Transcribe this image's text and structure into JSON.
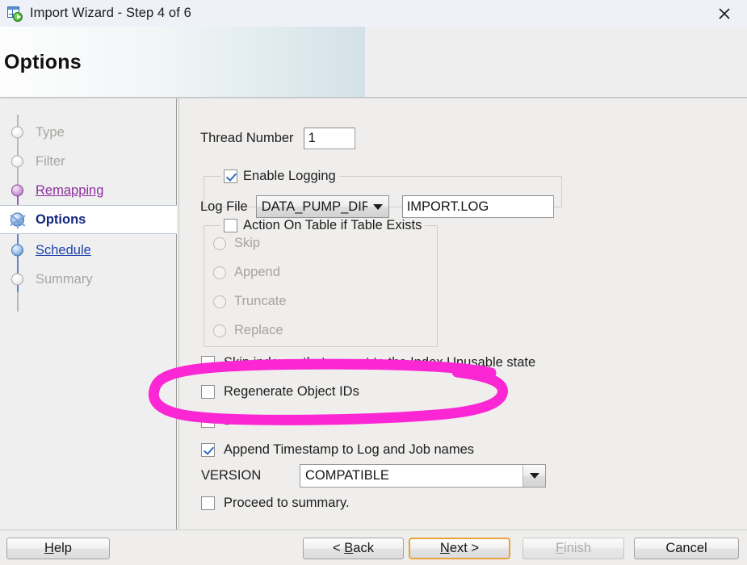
{
  "window": {
    "title": "Import Wizard - Step 4 of 6",
    "icon": "import-table-play-icon",
    "close_label": "✕"
  },
  "header": {
    "title": "Options"
  },
  "sidebar": {
    "items": [
      {
        "label": "Type",
        "state": "done-dim",
        "icon": "step-node-gray-icon"
      },
      {
        "label": "Filter",
        "state": "done-dim",
        "icon": "step-node-gray-icon"
      },
      {
        "label": "Remapping",
        "state": "visited",
        "icon": "step-node-purple-icon"
      },
      {
        "label": "Options",
        "state": "current",
        "icon": "step-node-current-icon"
      },
      {
        "label": "Schedule",
        "state": "link",
        "icon": "step-node-blue-icon"
      },
      {
        "label": "Summary",
        "state": "done-dim",
        "icon": "step-node-gray-icon"
      }
    ]
  },
  "form": {
    "thread_number": {
      "label": "Thread Number",
      "value": "1"
    },
    "logging": {
      "group_label": "Enable Logging",
      "checked": true,
      "log_file_label": "Log File",
      "directory": "DATA_PUMP_DIR",
      "file_name": "IMPORT.LOG"
    },
    "table_action": {
      "group_label": "Action On Table if Table Exists",
      "checked": false,
      "options": [
        "Skip",
        "Append",
        "Truncate",
        "Replace"
      ],
      "selected": ""
    },
    "checkboxes": [
      {
        "label": "Skip indexes that are set to the Index Unusable state",
        "checked": false
      },
      {
        "label": "Regenerate Object IDs",
        "checked": false
      },
      {
        "label": "Delete Master table",
        "checked": false
      },
      {
        "label": "Append Timestamp to Log and Job names",
        "checked": true
      }
    ],
    "version": {
      "label": "VERSION",
      "value": "COMPATIBLE"
    },
    "proceed": {
      "label": "Proceed to summary.",
      "checked": false
    }
  },
  "buttons": {
    "help": "Help",
    "back": "< Back",
    "next": "Next >",
    "finish": "Finish",
    "cancel": "Cancel"
  },
  "annotation": {
    "shape": "ellipse-highlight",
    "color": "#fb27d4",
    "targets": "Regenerate Object IDs"
  }
}
